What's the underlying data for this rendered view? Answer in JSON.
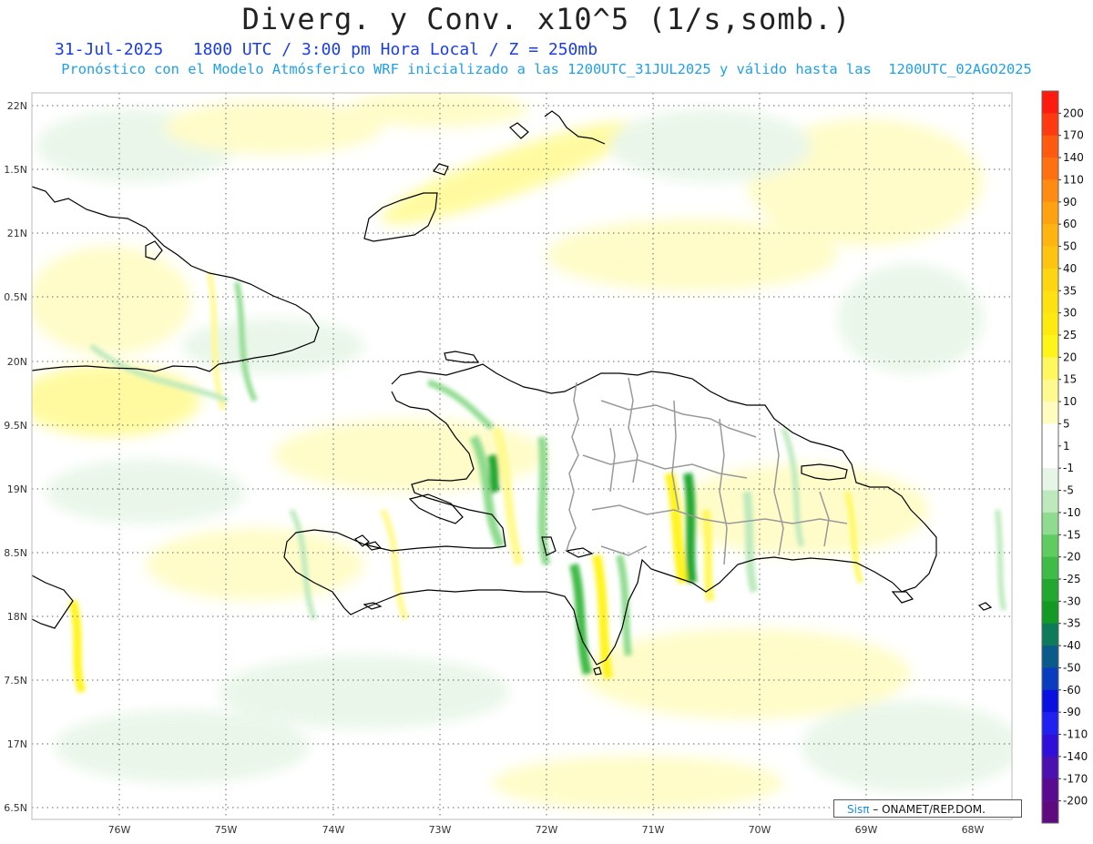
{
  "header": {
    "title": "Diverg. y Conv. x10^5 (1/s,somb.)",
    "date": "31-Jul-2025",
    "time_info": "1800 UTC / 3:00 pm Hora Local / Z = 250mb",
    "subtitle": "Pronóstico con el Modelo Atmósferico WRF inicializado a las 1200UTC_31JUL2025 y válido hasta las  1200UTC_02AGO2025"
  },
  "map": {
    "lat_labels": [
      "22N",
      "1.5N",
      "21N",
      "0.5N",
      "20N",
      "9.5N",
      "19N",
      "8.5N",
      "18N",
      "7.5N",
      "17N",
      "6.5N"
    ],
    "lon_labels": [
      "76W",
      "75W",
      "74W",
      "73W",
      "72W",
      "71W",
      "70W",
      "69W",
      "68W"
    ],
    "colors": {
      "convergence": "#35b84a",
      "divergence": "#ffee22",
      "coast": "#000000",
      "provinces": "#999999"
    }
  },
  "colorbar": {
    "labels": [
      "200",
      "170",
      "140",
      "110",
      "90",
      "60",
      "50",
      "40",
      "35",
      "30",
      "25",
      "20",
      "15",
      "10",
      "5",
      "1",
      "-1",
      "-5",
      "-10",
      "-15",
      "-20",
      "-25",
      "-30",
      "-35",
      "-40",
      "-50",
      "-60",
      "-90",
      "-110",
      "-140",
      "-170",
      "-200"
    ],
    "colors": [
      "#ff1a10",
      "#ff3a10",
      "#ff5a10",
      "#ff7010",
      "#ff8c10",
      "#ffa210",
      "#ffb410",
      "#ffc410",
      "#ffd410",
      "#ffe010",
      "#ffea10",
      "#fff41a",
      "#fff85c",
      "#fffa90",
      "#fffcc0",
      "#ffffff",
      "#ffffff",
      "#e6f5e6",
      "#bde9bd",
      "#8fdb8f",
      "#5fcc62",
      "#3fbb47",
      "#22a830",
      "#139a25",
      "#0d7a5a",
      "#0a5a8a",
      "#0a3cc0",
      "#0a10e0",
      "#2020f0",
      "#3010d8",
      "#4a10b0",
      "#5a0a90",
      "#600a80"
    ]
  },
  "credit": {
    "logo": "Sisπ",
    "text": "– ONAMET/REP.DOM."
  }
}
